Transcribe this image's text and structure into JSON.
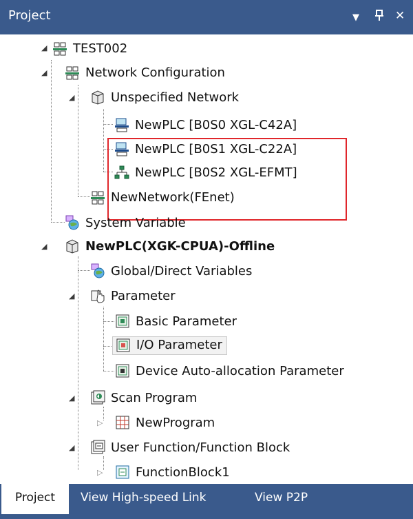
{
  "panel": {
    "title": "Project",
    "dropdown_icon": "chevron-down-icon",
    "pin_icon": "pin-icon",
    "close_icon": "close-icon"
  },
  "tree": {
    "root": "TEST002",
    "network_configuration": "Network Configuration",
    "unspecified_network": "Unspecified Network",
    "plc_1": "NewPLC [B0S0 XGL-C42A]",
    "plc_2": "NewPLC [B0S1 XGL-C22A]",
    "plc_3": "NewPLC [B0S2 XGL-EFMT]",
    "new_network": "NewNetwork(FEnet)",
    "system_variable": "System Variable",
    "plc_offline": "NewPLC(XGK-CPUA)-Offline",
    "global_variables": "Global/Direct Variables",
    "parameter": "Parameter",
    "basic_parameter": "Basic Parameter",
    "io_parameter": "I/O Parameter",
    "device_auto_param": "Device Auto-allocation Parameter",
    "scan_program": "Scan Program",
    "new_program": "NewProgram",
    "user_function": "User Function/Function Block",
    "function_block": "FunctionBlock1"
  },
  "tabs": {
    "project": "Project",
    "high_speed_link": "View High-speed Link",
    "p2p": "View P2P"
  },
  "colors": {
    "titlebar": "#3a5a8c",
    "highlight_border": "#e0262b",
    "selection_bg": "#f2f2f2"
  }
}
